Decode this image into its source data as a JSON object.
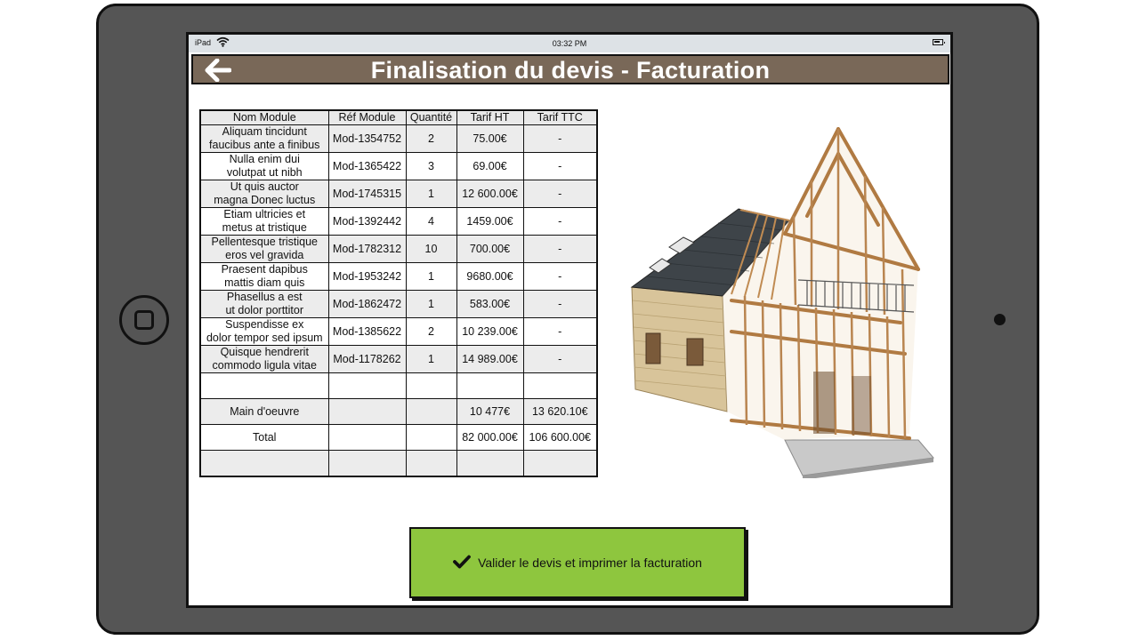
{
  "status_bar": {
    "device": "iPad",
    "time": "03:32 PM"
  },
  "header": {
    "title": "Finalisation du devis - Facturation"
  },
  "table": {
    "columns": [
      "Nom Module",
      "Réf Module",
      "Quantité",
      "Tarif HT",
      "Tarif TTC"
    ],
    "rows": [
      {
        "name_line1": "Aliquam tincidunt",
        "name_line2": "faucibus ante a finibus",
        "ref": "Mod-1354752",
        "qty": "2",
        "ht": "75.00€",
        "ttc": "-"
      },
      {
        "name_line1": "Nulla enim dui",
        "name_line2": "volutpat ut nibh",
        "ref": "Mod-1365422",
        "qty": "3",
        "ht": "69.00€",
        "ttc": "-"
      },
      {
        "name_line1": "Ut quis auctor",
        "name_line2": "magna Donec luctus",
        "ref": "Mod-1745315",
        "qty": "1",
        "ht": "12 600.00€",
        "ttc": "-"
      },
      {
        "name_line1": "Etiam ultricies et",
        "name_line2": "metus at tristique",
        "ref": "Mod-1392442",
        "qty": "4",
        "ht": "1459.00€",
        "ttc": "-"
      },
      {
        "name_line1": "Pellentesque tristique",
        "name_line2": "eros vel gravida",
        "ref": "Mod-1782312",
        "qty": "10",
        "ht": "700.00€",
        "ttc": "-"
      },
      {
        "name_line1": "Praesent dapibus",
        "name_line2": "mattis diam quis",
        "ref": "Mod-1953242",
        "qty": "1",
        "ht": "9680.00€",
        "ttc": "-"
      },
      {
        "name_line1": "Phasellus a est",
        "name_line2": "ut dolor porttitor",
        "ref": "Mod-1862472",
        "qty": "1",
        "ht": "583.00€",
        "ttc": "-"
      },
      {
        "name_line1": "Suspendisse ex",
        "name_line2": "dolor tempor sed ipsum",
        "ref": "Mod-1385622",
        "qty": "2",
        "ht": "10 239.00€",
        "ttc": "-"
      },
      {
        "name_line1": "Quisque hendrerit",
        "name_line2": "commodo ligula vitae",
        "ref": "Mod-1178262",
        "qty": "1",
        "ht": "14 989.00€",
        "ttc": "-"
      }
    ],
    "labor": {
      "label": "Main d'oeuvre",
      "ht": "10 477€",
      "ttc": "13 620.10€"
    },
    "total": {
      "label": "Total",
      "ht": "82 000.00€",
      "ttc": "106 600.00€"
    }
  },
  "image": {
    "subject": "house-frame-3d-render"
  },
  "actions": {
    "validate_label": "Valider le devis et imprimer la facturation"
  },
  "colors": {
    "header_bg": "#796858",
    "button_bg": "#8ec63e",
    "device_body": "#555555"
  },
  "icons": {
    "back": "arrow-left-icon",
    "validate": "checkmark-icon",
    "wifi": "wifi-icon",
    "battery": "battery-icon"
  }
}
